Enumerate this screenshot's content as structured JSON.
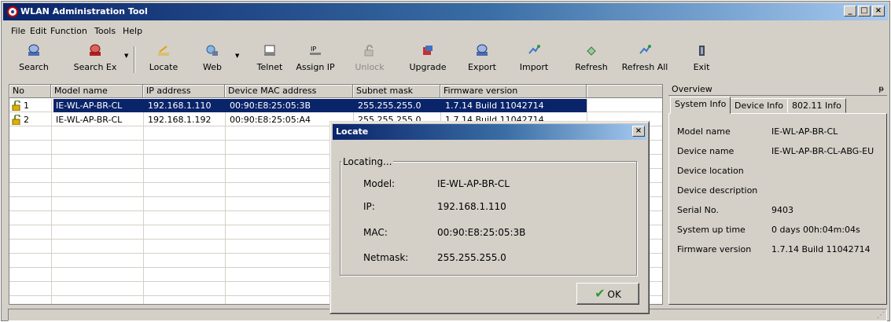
{
  "window": {
    "title": "WLAN Administration Tool",
    "controls": {
      "minimize": "_",
      "maximize": "□",
      "close": "×"
    }
  },
  "menu": {
    "items": [
      {
        "label": "File"
      },
      {
        "label": "Edit"
      },
      {
        "label": "Function"
      },
      {
        "label": "Tools"
      },
      {
        "label": "Help"
      }
    ]
  },
  "toolbar": {
    "items": [
      {
        "label": "Search",
        "icon": "search-icon"
      },
      {
        "label": "Search Ex",
        "icon": "search-ex-icon"
      },
      {
        "label": "Locate",
        "icon": "locate-icon"
      },
      {
        "label": "Web",
        "icon": "web-icon"
      },
      {
        "label": "Telnet",
        "icon": "telnet-icon"
      },
      {
        "label": "Assign IP",
        "icon": "assign-ip-icon"
      },
      {
        "label": "Unlock",
        "icon": "unlock-icon",
        "disabled": true
      },
      {
        "label": "Upgrade",
        "icon": "upgrade-icon"
      },
      {
        "label": "Export",
        "icon": "export-icon"
      },
      {
        "label": "Import",
        "icon": "import-icon"
      },
      {
        "label": "Refresh",
        "icon": "refresh-icon"
      },
      {
        "label": "Refresh All",
        "icon": "refresh-all-icon"
      },
      {
        "label": "Exit",
        "icon": "exit-icon"
      }
    ]
  },
  "device_list": {
    "columns": [
      "No",
      "Model name",
      "IP address",
      "Device MAC address",
      "Subnet mask",
      "Firmware version"
    ],
    "rows": [
      {
        "no": "1",
        "model": "IE-WL-AP-BR-CL",
        "ip": "192.168.1.110",
        "mac": "00:90:E8:25:05:3B",
        "mask": "255.255.255.0",
        "firmware": "1.7.14 Build 11042714",
        "selected": true
      },
      {
        "no": "2",
        "model": "IE-WL-AP-BR-CL",
        "ip": "192.168.1.192",
        "mac": "00:90:E8:25:05:A4",
        "mask": "255.255.255.0",
        "firmware": "1.7.14 Build 11042714",
        "selected": false
      }
    ]
  },
  "overview": {
    "title": "Overview",
    "pin": "ᵽ",
    "tabs": [
      {
        "label": "System Info",
        "active": true
      },
      {
        "label": "Device Info",
        "active": false
      },
      {
        "label": "802.11 Info",
        "active": false
      }
    ],
    "fields": [
      {
        "label": "Model name",
        "value": "IE-WL-AP-BR-CL"
      },
      {
        "label": "Device name",
        "value": "IE-WL-AP-BR-CL-ABG-EU"
      },
      {
        "label": "Device location",
        "value": ""
      },
      {
        "label": "Device description",
        "value": ""
      },
      {
        "label": "Serial No.",
        "value": "9403"
      },
      {
        "label": "System up time",
        "value": "0 days 00h:04m:04s"
      },
      {
        "label": "Firmware version",
        "value": "1.7.14 Build 11042714"
      }
    ]
  },
  "locate_dialog": {
    "title": "Locate",
    "close": "×",
    "group_label": "Locating...",
    "fields": [
      {
        "label": "Model:",
        "value": "IE-WL-AP-BR-CL"
      },
      {
        "label": "IP:",
        "value": "192.168.1.110"
      },
      {
        "label": "MAC:",
        "value": "00:90:E8:25:05:3B"
      },
      {
        "label": "Netmask:",
        "value": "255.255.255.0"
      }
    ],
    "ok_label": "OK",
    "ok_icon": "✔"
  },
  "statusbar": {
    "text": ""
  },
  "colors": {
    "title_start": "#0a246a",
    "title_end": "#a6caf0",
    "face": "#d4d0c8",
    "selection": "#0a246a"
  }
}
